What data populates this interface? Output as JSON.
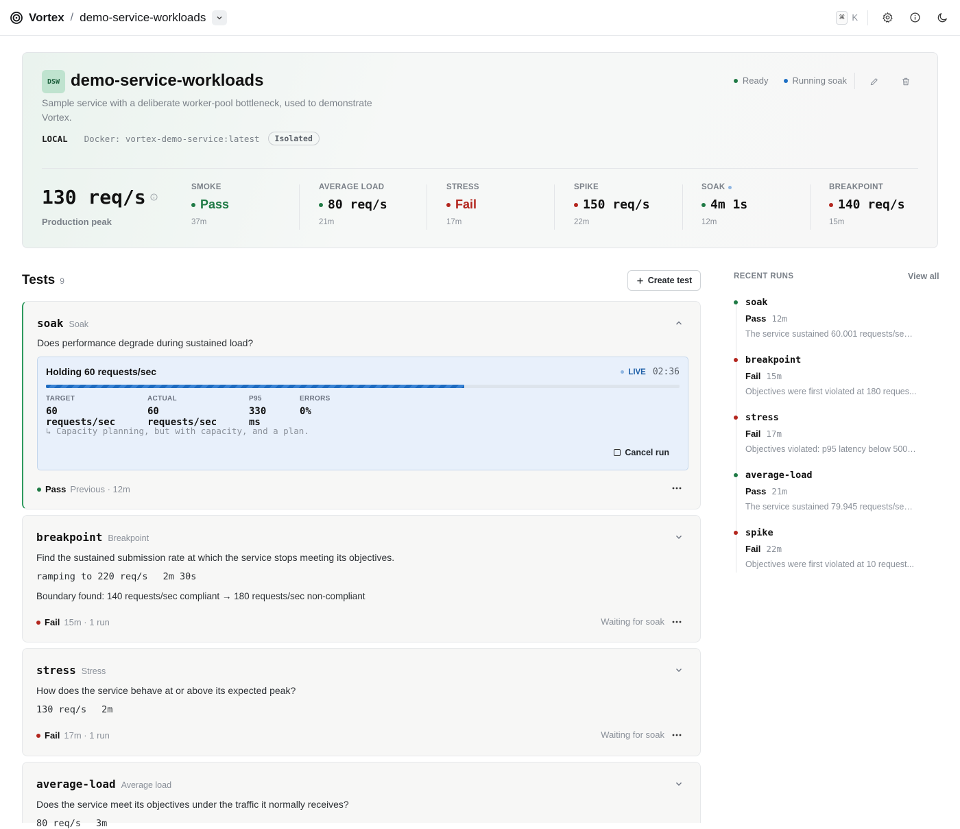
{
  "topbar": {
    "brand": "Vortex",
    "separator": "/",
    "crumb": "demo-service-workloads",
    "shortcut_key_1": "⌘",
    "shortcut_key_2": "K"
  },
  "service": {
    "badge": "DSW",
    "title": "demo-service-workloads",
    "description": "Sample service with a deliberate worker-pool bottleneck, used to demonstrate Vortex.",
    "env": "LOCAL",
    "image": "Docker: vortex-demo-service:latest",
    "isolation": "Isolated",
    "status_ready": "Ready",
    "status_running": "Running soak",
    "peak_value": "130 req/s",
    "peak_label": "Production peak",
    "metrics": [
      {
        "label": "SMOKE",
        "value": "Pass",
        "time": "37m"
      },
      {
        "label": "AVERAGE LOAD",
        "value": "80 req/s",
        "time": "21m"
      },
      {
        "label": "STRESS",
        "value": "Fail",
        "time": "17m"
      },
      {
        "label": "SPIKE",
        "value": "150 req/s",
        "time": "22m"
      },
      {
        "label": "SOAK",
        "value": "4m 1s",
        "time": "12m"
      },
      {
        "label": "BREAKPOINT",
        "value": "140 req/s",
        "time": "15m"
      }
    ]
  },
  "tests": {
    "title": "Tests",
    "count": "9",
    "create_label": "Create test",
    "soak": {
      "name": "soak",
      "kind": "Soak",
      "question": "Does performance degrade during sustained load?",
      "live_title": "Holding 60 requests/sec",
      "live_label": "LIVE",
      "live_time": "02:36",
      "progress": 0.66,
      "target_label": "TARGET",
      "target_value": "60 requests/sec",
      "actual_label": "ACTUAL",
      "actual_value": "60 requests/sec",
      "p95_label": "P95",
      "p95_value": "330 ms",
      "errors_label": "ERRORS",
      "errors_value": "0%",
      "quote": "↳ Capacity planning, but with capacity, and a plan.",
      "cancel_label": "Cancel run",
      "result": "Pass",
      "result_sub": "Previous · 12m"
    },
    "breakpoint": {
      "name": "breakpoint",
      "kind": "Breakpoint",
      "question": "Find the sustained submission rate at which the service stops meeting its objectives.",
      "param_1": "ramping to 220 req/s",
      "param_2": "2m 30s",
      "boundary": "Boundary found: 140 requests/sec compliant → 180 requests/sec non-compliant",
      "result": "Fail",
      "result_sub": "15m · 1 run",
      "waiting": "Waiting for soak"
    },
    "stress": {
      "name": "stress",
      "kind": "Stress",
      "question": "How does the service behave at or above its expected peak?",
      "param_1": "130 req/s",
      "param_2": "2m",
      "result": "Fail",
      "result_sub": "17m · 1 run",
      "waiting": "Waiting for soak"
    },
    "average_load": {
      "name": "average-load",
      "kind": "Average load",
      "question": "Does the service meet its objectives under the traffic it normally receives?",
      "param_1": "80 req/s",
      "param_2": "3m"
    }
  },
  "recent_runs": {
    "title": "RECENT RUNS",
    "view_all": "View all",
    "items": [
      {
        "name": "soak",
        "result": "Pass",
        "time": "12m",
        "detail": "The service sustained 60.001 requests/sec ..."
      },
      {
        "name": "breakpoint",
        "result": "Fail",
        "time": "15m",
        "detail": "Objectives were first violated at 180 reques..."
      },
      {
        "name": "stress",
        "result": "Fail",
        "time": "17m",
        "detail": "Objectives violated: p95 latency below 500 ..."
      },
      {
        "name": "average-load",
        "result": "Pass",
        "time": "21m",
        "detail": "The service sustained 79.945 requests/sec ..."
      },
      {
        "name": "spike",
        "result": "Fail",
        "time": "22m",
        "detail": "Objectives were first violated at 10 request..."
      }
    ]
  },
  "colors": {
    "pass": "#1f7a45",
    "fail": "#b3261e",
    "running": "#1d6fc4",
    "accent_border": "#2e9a5e"
  }
}
